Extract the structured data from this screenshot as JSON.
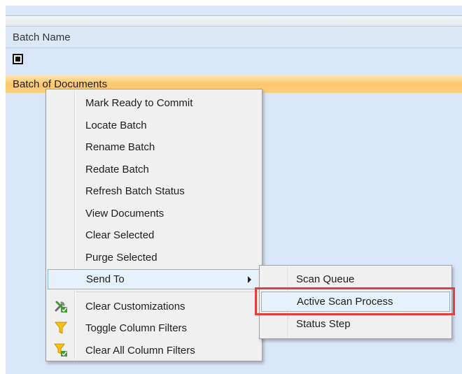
{
  "grid": {
    "column_header": "Batch Name",
    "filter_icon": "filter-checkbox-icon",
    "selected_row": "Batch of Documents",
    "row_color": "#fbc56a"
  },
  "context_menu": {
    "items": [
      {
        "label": "Mark Ready to Commit"
      },
      {
        "label": "Locate Batch"
      },
      {
        "label": "Rename Batch"
      },
      {
        "label": "Redate Batch"
      },
      {
        "label": "Refresh Batch Status"
      },
      {
        "label": "View Documents"
      },
      {
        "label": "Clear Selected"
      },
      {
        "label": "Purge Selected"
      },
      {
        "label": "Send To",
        "has_submenu": true,
        "state": "hover"
      },
      {
        "label": "Clear Customizations",
        "icon": "tools-icon"
      },
      {
        "label": "Toggle Column Filters",
        "icon": "funnel-icon"
      },
      {
        "label": "Clear All Column Filters",
        "icon": "funnel-clear-icon"
      }
    ]
  },
  "submenu": {
    "items": [
      {
        "label": "Scan Queue"
      },
      {
        "label": "Active Scan Process",
        "state": "hover",
        "highlighted": true
      },
      {
        "label": "Status Step"
      }
    ]
  },
  "colors": {
    "menu_hover_bg": "#e6f1fb",
    "menu_hover_border": "#84b6e4",
    "highlight_outline": "#e2403e",
    "grid_bg": "#d9e6f7"
  }
}
